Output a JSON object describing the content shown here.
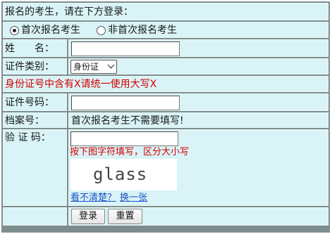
{
  "header": {
    "prompt": "报名的考生，请在下方登录："
  },
  "mode": {
    "option_first": "首次报名考生",
    "option_repeat": "非首次报名考生",
    "selected": "首次报名考生"
  },
  "form": {
    "name_label": "姓　　名：",
    "name_value": "",
    "idtype_label": "证件类别：",
    "idtype_selected": "身份证",
    "id_notice": "身份证号中含有X请统一使用大写X",
    "idnum_label": "证件号码：",
    "idnum_value": "",
    "archive_label": "档案号：",
    "archive_note": "首次报名考生不需要填写!",
    "captcha_label": "验 证 码：",
    "captcha_value": "",
    "captcha_hint": "按下图字符填写，区分大小写",
    "captcha_image_text": "glass",
    "captcha_refresh_q": "看不清楚？",
    "captcha_refresh_link": "换一张"
  },
  "actions": {
    "submit_label": "登录",
    "reset_label": "重置"
  },
  "colors": {
    "cell_bg": "#d9f3f6",
    "grid": "#7d8c8c",
    "notice_red": "#d60000",
    "link_blue": "#1a52c6"
  }
}
